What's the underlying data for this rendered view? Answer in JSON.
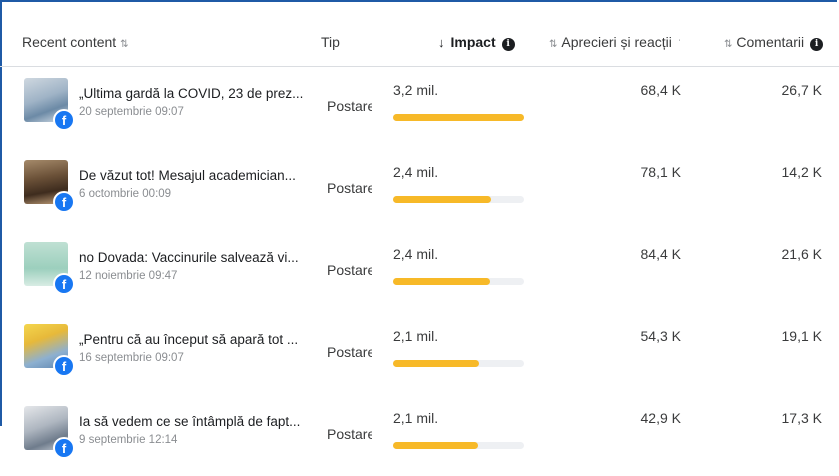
{
  "header": {
    "recent_content": "Recent content",
    "tip": "Tip",
    "impact": "Impact",
    "aprecieri": "Aprecieri și reacții",
    "comentarii": "Comentarii"
  },
  "colors": {
    "accent_bar": "#f7b928",
    "facebook_blue": "#1877f2",
    "frame_border": "#1f5aa6"
  },
  "rows": [
    {
      "title": "„Ultima gardă la COVID, 23 de prez...",
      "date": "20 septembrie 09:07",
      "tip": "Postare",
      "impact": "3,2 mil.",
      "impact_fraction": 1.0,
      "aprecieri": "68,4 K",
      "comentarii": "26,7 K"
    },
    {
      "title": "De văzut tot! Mesajul academician...",
      "date": "6 octombrie 00:09",
      "tip": "Postare",
      "impact": "2,4 mil.",
      "impact_fraction": 0.75,
      "aprecieri": "78,1 K",
      "comentarii": "14,2 K"
    },
    {
      "title": "no Dovada: Vaccinurile salvează vi...",
      "date": "12 noiembrie 09:47",
      "tip": "Postare",
      "impact": "2,4 mil.",
      "impact_fraction": 0.74,
      "aprecieri": "84,4 K",
      "comentarii": "21,6 K"
    },
    {
      "title": "„Pentru că au început să apară tot ...",
      "date": "16 septembrie 09:07",
      "tip": "Postare",
      "impact": "2,1 mil.",
      "impact_fraction": 0.66,
      "aprecieri": "54,3 K",
      "comentarii": "19,1 K"
    },
    {
      "title": "Ia să vedem ce se întâmplă de fapt...",
      "date": "9 septembrie 12:14",
      "tip": "Postare",
      "impact": "2,1 mil.",
      "impact_fraction": 0.65,
      "aprecieri": "42,9 K",
      "comentarii": "17,3 K"
    }
  ]
}
